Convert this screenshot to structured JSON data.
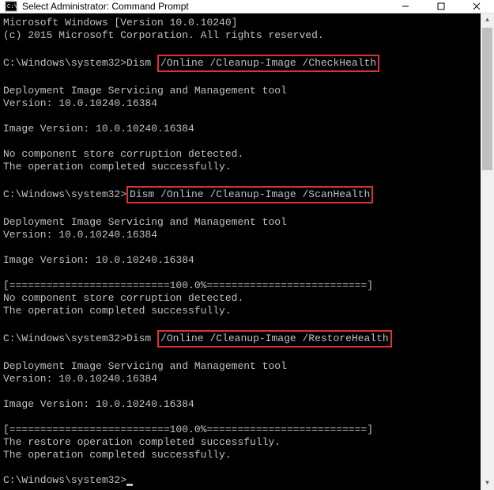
{
  "titlebar": {
    "title": "Select Administrator: Command Prompt"
  },
  "terminal": {
    "prompt": "C:\\Windows\\system32>",
    "lines": {
      "winver": "Microsoft Windows [Version 10.0.10240]",
      "copyright": "(c) 2015 Microsoft Corporation. All rights reserved.",
      "dism1_prefix": "C:\\Windows\\system32>Dism ",
      "dism1_hl": "/Online /Cleanup-Image /CheckHealth",
      "tool": "Deployment Image Servicing and Management tool",
      "toolver": "Version: 10.0.10240.16384",
      "imgver": "Image Version: 10.0.10240.16384",
      "nocorrupt": "No component store corruption detected.",
      "success": "The operation completed successfully.",
      "dism2_prefix": "C:\\Windows\\system32>",
      "dism2_hl": "Dism /Online /Cleanup-Image /ScanHealth",
      "progress": "[==========================100.0%==========================] ",
      "dism3_prefix": "C:\\Windows\\system32>Dism ",
      "dism3_hl": "/Online /Cleanup-Image /RestoreHealth",
      "restore_success": "The restore operation completed successfully."
    }
  },
  "colors": {
    "highlight_border": "#d33"
  }
}
